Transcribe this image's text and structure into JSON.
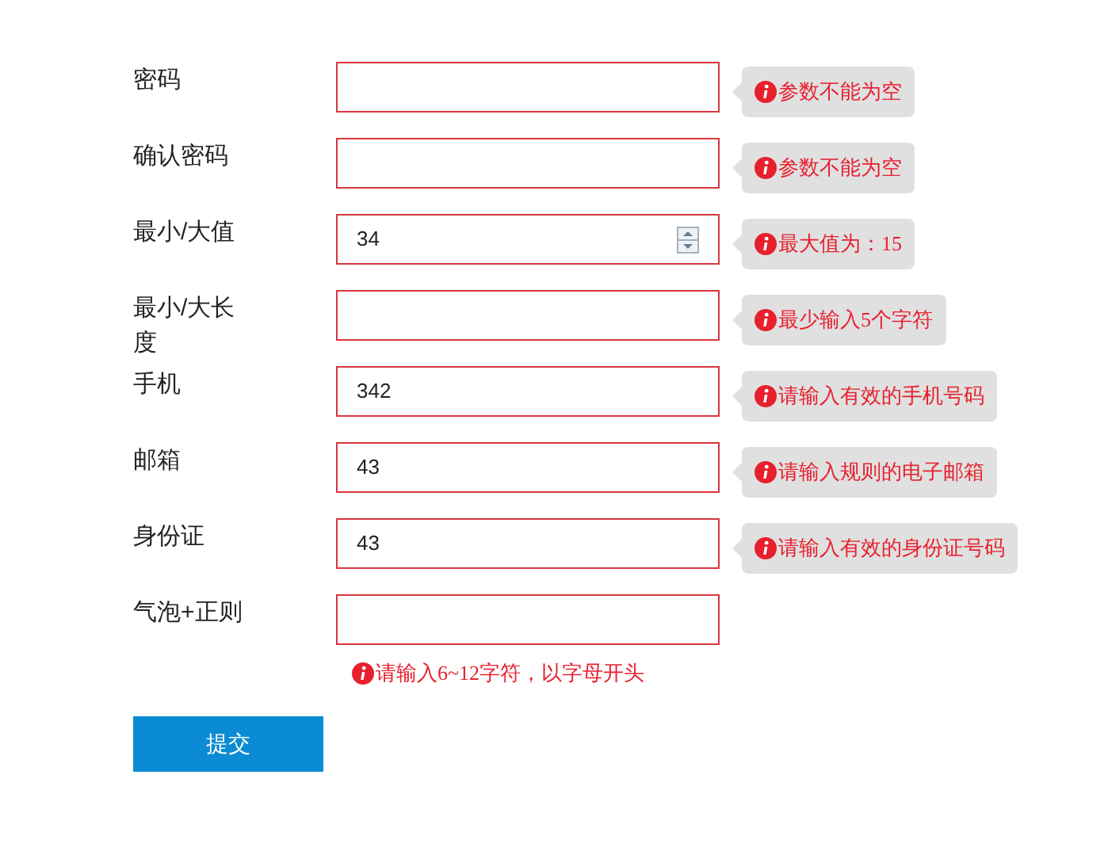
{
  "fields": [
    {
      "label": "密码",
      "kind": "text",
      "error": {
        "kind": "bubble",
        "text": "参数不能为空"
      }
    },
    {
      "label": "确认密码",
      "kind": "text",
      "error": {
        "kind": "bubble",
        "text": "参数不能为空"
      }
    },
    {
      "label": "最小/大值",
      "kind": "number",
      "value": "34",
      "error": {
        "kind": "bubble",
        "text": "最大值为：15"
      }
    },
    {
      "label": "最小/大长度",
      "kind": "text",
      "error": {
        "kind": "bubble",
        "text": "最少输入5个字符"
      }
    },
    {
      "label": "手机",
      "kind": "text",
      "value": "342",
      "error": {
        "kind": "bubble",
        "text": "请输入有效的手机号码"
      }
    },
    {
      "label": "邮箱",
      "kind": "text",
      "value": "43",
      "error": {
        "kind": "bubble",
        "text": "请输入规则的电子邮箱"
      }
    },
    {
      "label": "身份证",
      "kind": "text",
      "value": "43",
      "error": {
        "kind": "bubble",
        "text": "请输入有效的身份证号码"
      }
    },
    {
      "label": "气泡+正则",
      "kind": "text",
      "error": {
        "kind": "inline",
        "text": "请输入6~12字符，以字母开头"
      }
    }
  ],
  "submit": "提交"
}
